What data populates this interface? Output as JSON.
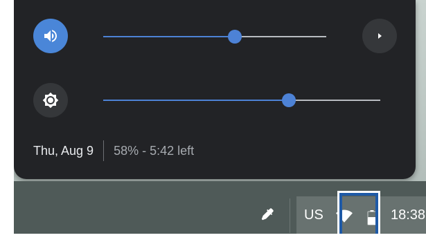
{
  "quick_settings": {
    "volume": {
      "icon": "volume-icon",
      "level": 0.59,
      "accent_color": "#4d82d6"
    },
    "audio_detail_icon": "chevron-right-icon",
    "brightness": {
      "icon": "brightness-icon",
      "level": 0.67
    },
    "date": "Thu, Aug 9",
    "battery_status": "58% - 5:42 left"
  },
  "shelf": {
    "stylus_icon": "stylus-icon",
    "ime_label": "US",
    "wifi_icon": "wifi-icon",
    "battery_icon": "battery-icon",
    "clock": "18:38",
    "highlight_color": "#1f5aa6"
  }
}
